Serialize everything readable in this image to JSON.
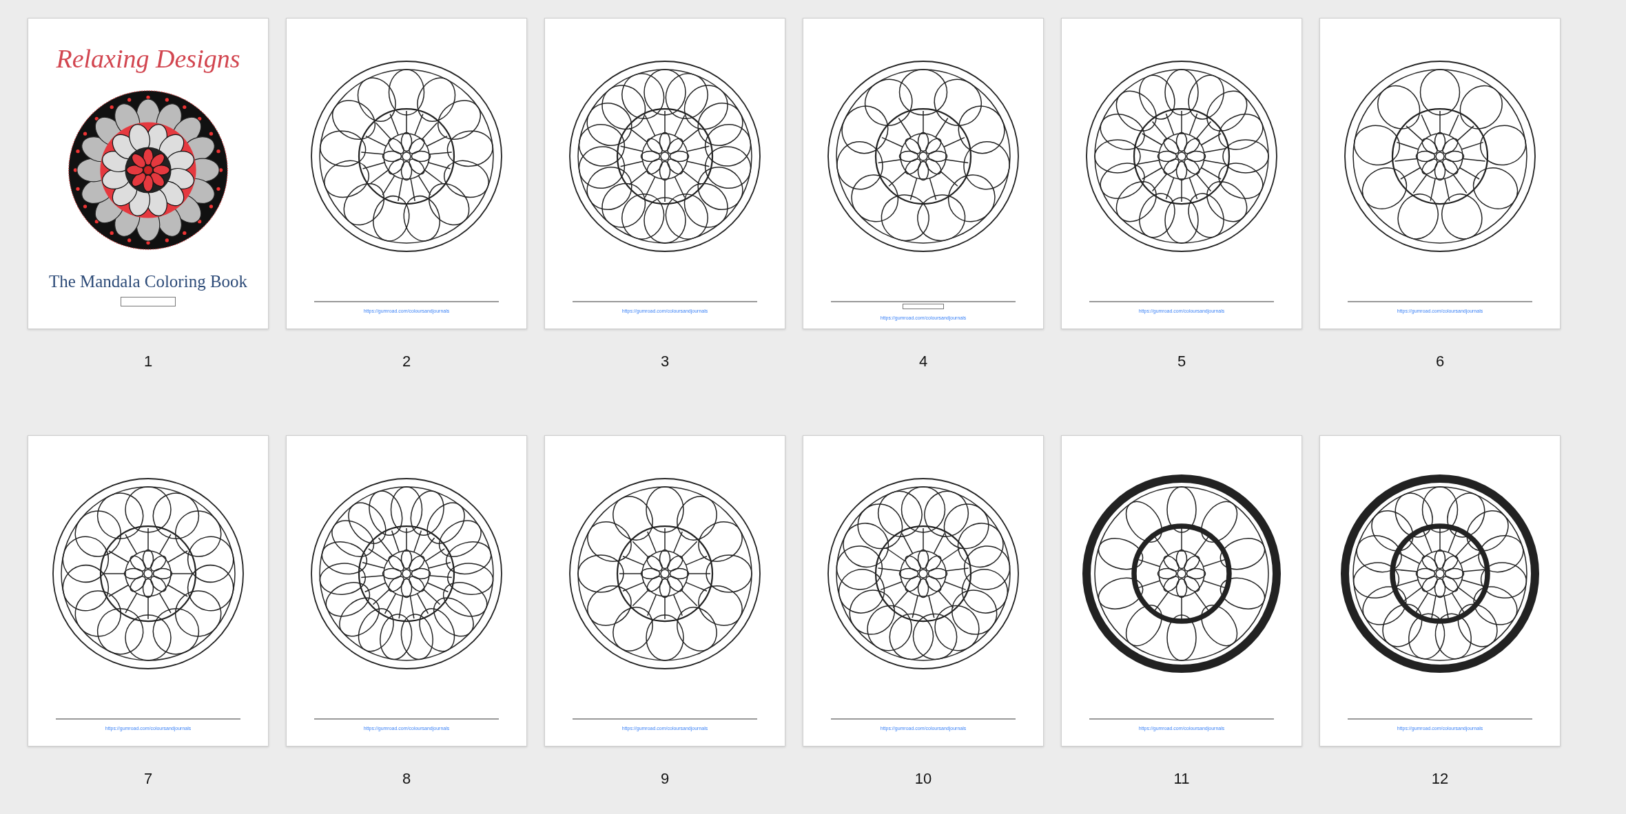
{
  "pages": [
    {
      "number": "1",
      "kind": "cover",
      "title": "Relaxing Designs",
      "subtitle": "The Mandala Coloring Book",
      "box": true
    },
    {
      "number": "2",
      "kind": "mandala",
      "link": "https://gumroad.com/coloursandjournals",
      "box": false
    },
    {
      "number": "3",
      "kind": "mandala",
      "link": "https://gumroad.com/coloursandjournals",
      "box": false
    },
    {
      "number": "4",
      "kind": "mandala",
      "link": "https://gumroad.com/coloursandjournals",
      "box": true
    },
    {
      "number": "5",
      "kind": "mandala",
      "link": "https://gumroad.com/coloursandjournals",
      "box": false
    },
    {
      "number": "6",
      "kind": "mandala",
      "link": "https://gumroad.com/coloursandjournals",
      "box": false
    },
    {
      "number": "7",
      "kind": "mandala",
      "link": "https://gumroad.com/coloursandjournals",
      "box": false
    },
    {
      "number": "8",
      "kind": "mandala",
      "link": "https://gumroad.com/coloursandjournals",
      "box": false
    },
    {
      "number": "9",
      "kind": "mandala",
      "link": "https://gumroad.com/coloursandjournals",
      "box": false
    },
    {
      "number": "10",
      "kind": "mandala",
      "link": "https://gumroad.com/coloursandjournals",
      "box": false
    },
    {
      "number": "11",
      "kind": "mandala",
      "link": "https://gumroad.com/coloursandjournals",
      "box": false
    },
    {
      "number": "12",
      "kind": "mandala",
      "link": "https://gumroad.com/coloursandjournals",
      "box": false
    }
  ]
}
